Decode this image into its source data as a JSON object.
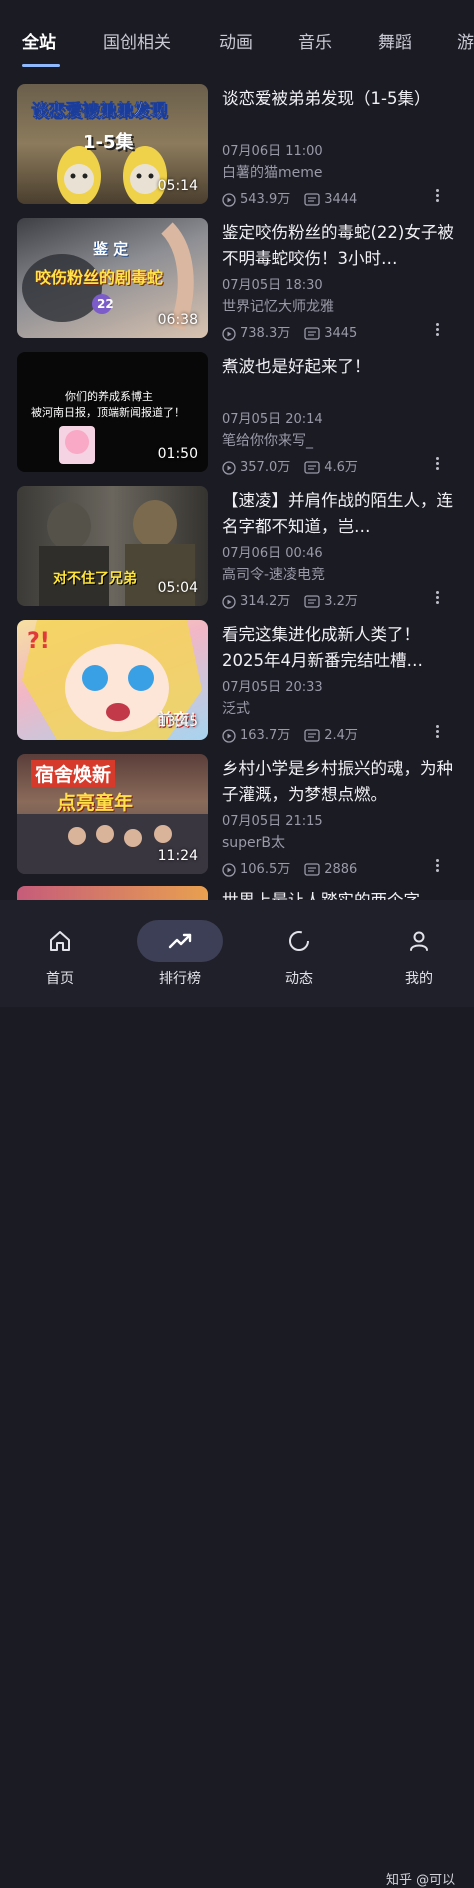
{
  "tabs": [
    {
      "label": "全站",
      "active": true
    },
    {
      "label": "国创相关"
    },
    {
      "label": "动画"
    },
    {
      "label": "音乐"
    },
    {
      "label": "舞蹈"
    },
    {
      "label": "游"
    }
  ],
  "videos": [
    {
      "title": "谈恋爱被弟弟发现（1-5集）",
      "date": "07月06日 11:00",
      "author": "白薯的猫meme",
      "views": "543.9万",
      "danmaku": "3444",
      "duration": "05:14",
      "thumb_text_1": "谈恋爱被弟弟发现",
      "thumb_text_2": "1-5集"
    },
    {
      "title": "鉴定咬伤粉丝的毒蛇(22)女子被不明毒蛇咬伤！3小时…",
      "date": "07月05日 18:30",
      "author": "世界记忆大师龙雅",
      "views": "738.3万",
      "danmaku": "3445",
      "duration": "06:38",
      "thumb_text_1": "鉴 定",
      "thumb_text_2": "咬伤粉丝的剧毒蛇",
      "thumb_text_3": "22"
    },
    {
      "title": "煮波也是好起来了！",
      "date": "07月05日 20:14",
      "author": "笔给你你来写_",
      "views": "357.0万",
      "danmaku": "4.6万",
      "duration": "01:50",
      "thumb_text_1": "你们的养成系博主",
      "thumb_text_2": "被河南日报，顶端新闻报道了！"
    },
    {
      "title": "【速凌】并肩作战的陌生人，连名字都不知道，岂…",
      "date": "07月06日 00:46",
      "author": "高司令-速凌电竞",
      "views": "314.2万",
      "danmaku": "3.2万",
      "duration": "05:04",
      "thumb_text_1": "对不住了兄弟"
    },
    {
      "title": "看完这集进化成新人类了！2025年4月新番完结吐槽…",
      "date": "07月05日 20:33",
      "author": "泛式",
      "views": "163.7万",
      "danmaku": "2.4万",
      "duration": "13:45",
      "thumb_text_1": "前夜！"
    },
    {
      "title": "乡村小学是乡村振兴的魂，为种子灌溉，为梦想点燃。",
      "date": "07月05日 21:15",
      "author": "superB太",
      "views": "106.5万",
      "danmaku": "2886",
      "duration": "11:24",
      "thumb_text_1": "宿舍焕新",
      "thumb_text_2": "点亮童年"
    },
    {
      "title": "世界上最让人踏实的两个字",
      "date": "",
      "author": "",
      "views": "",
      "danmaku": "",
      "duration": ""
    }
  ],
  "nav": [
    {
      "label": "首页",
      "icon": "home-icon"
    },
    {
      "label": "排行榜",
      "icon": "trending-icon",
      "active": true
    },
    {
      "label": "动态",
      "icon": "activity-icon"
    },
    {
      "label": "我的",
      "icon": "profile-icon"
    }
  ],
  "watermark": "知乎 @可以",
  "colors": {
    "background": "#1b1b24",
    "accent": "#8fb8ff",
    "nav_active_bg": "#3c3f55"
  }
}
